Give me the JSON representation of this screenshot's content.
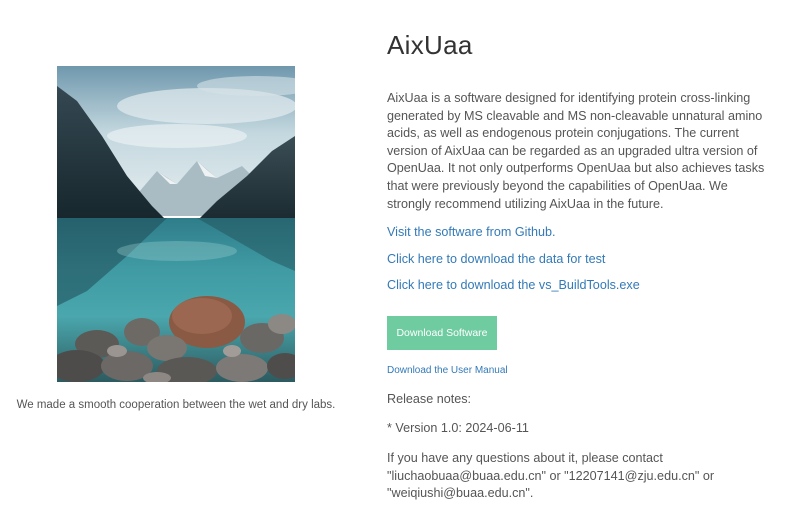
{
  "page": {
    "image_caption": "We made a smooth cooperation between the wet and dry labs.",
    "title": "AixUaa",
    "description": "AixUaa is a software designed for identifying protein cross-linking generated by MS cleavable and MS non-cleavable unnatural amino acids, as well as endogenous protein conjugations. The current version of AixUaa can be regarded as an upgraded ultra version of OpenUaa. It not only outperforms OpenUaa but also achieves tasks that were previously beyond the capabilities of OpenUaa. We strongly recommend utilizing AixUaa in the future.",
    "links": {
      "github": "Visit the software from Github.",
      "test_data": "Click here to download the data for test",
      "build_tools": "Click here to download the vs_BuildTools.exe"
    },
    "download_button": "Download Software",
    "manual_link": "Download the User Manual",
    "release_notes_label": "Release notes:",
    "version_note": "* Version 1.0: 2024-06-11",
    "contact_text": "If you have any questions about it, please contact \"liuchaobuaa@buaa.edu.cn\" or \"12207141@zju.edu.cn\" or \"weiqiushi@buaa.edu.cn\"."
  },
  "colors": {
    "accent_button": "#6fcca1",
    "link": "#337ab7",
    "text": "#555555",
    "title": "#333333"
  }
}
